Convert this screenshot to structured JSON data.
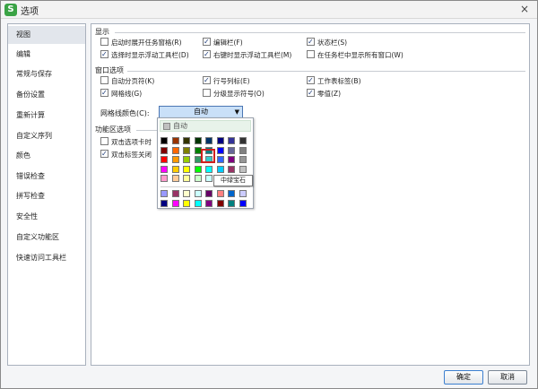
{
  "window": {
    "title": "选项",
    "close": "×"
  },
  "sidebar": {
    "items": [
      {
        "label": "视图",
        "active": true
      },
      {
        "label": "编辑"
      },
      {
        "label": "常规与保存"
      },
      {
        "label": "备份设置"
      },
      {
        "label": "重新计算"
      },
      {
        "label": "自定义序列"
      },
      {
        "label": "颜色"
      },
      {
        "label": "错误检查"
      },
      {
        "label": "拼写检查"
      },
      {
        "label": "安全性"
      },
      {
        "label": "自定义功能区"
      },
      {
        "label": "快速访问工具栏"
      }
    ]
  },
  "display": {
    "title": "显示",
    "options": [
      {
        "label": "启动时展开任务窗格(R)",
        "checked": false
      },
      {
        "label": "编辑栏(F)",
        "checked": true
      },
      {
        "label": "状态栏(S)",
        "checked": true
      },
      {
        "label": "选择时显示浮动工具栏(D)",
        "checked": true
      },
      {
        "label": "右键时显示浮动工具栏(M)",
        "checked": true
      },
      {
        "label": "在任务栏中显示所有窗口(W)",
        "checked": false
      }
    ]
  },
  "window_options": {
    "title": "窗口选项",
    "options": [
      {
        "label": "自动分页符(K)",
        "checked": false
      },
      {
        "label": "行号列标(E)",
        "checked": true
      },
      {
        "label": "工作表标签(B)",
        "checked": true
      },
      {
        "label": "网格线(G)",
        "checked": true
      },
      {
        "label": "分级显示符号(O)",
        "checked": false
      },
      {
        "label": "零值(Z)",
        "checked": true
      }
    ],
    "gridline_color_label": "网格线颜色(C):",
    "gridline_color_value": "自动",
    "dropdown_arrow": "▼"
  },
  "ribbon": {
    "title": "功能区选项",
    "options": [
      {
        "label": "双击选项卡时",
        "checked": false
      },
      {
        "label": "双击标签关闭",
        "checked": true
      }
    ]
  },
  "color_popup": {
    "auto_label": "自动",
    "hovered_color_name": "中绿宝石",
    "palette": [
      [
        "#000000",
        "#993300",
        "#333300",
        "#003300",
        "#003366",
        "#000080",
        "#333399",
        "#333333"
      ],
      [
        "#800000",
        "#ff6600",
        "#808000",
        "#008000",
        "#008080",
        "#0000ff",
        "#666699",
        "#808080"
      ],
      [
        "#ff0000",
        "#ff9900",
        "#99cc00",
        "#339966",
        "#33cccc",
        "#3366ff",
        "#800080",
        "#969696"
      ],
      [
        "#ff00ff",
        "#ffcc00",
        "#ffff00",
        "#00ff00",
        "#00ffff",
        "#00ccff",
        "#993366",
        "#c0c0c0"
      ],
      [
        "#ff99cc",
        "#ffcc99",
        "#ffff99",
        "#ccffcc",
        "#ccffff",
        "#99ccff",
        "#cc99ff",
        "#ffffff"
      ]
    ],
    "recent": [
      [
        "#9999ff",
        "#993366",
        "#ffffcc",
        "#ccffff",
        "#660066",
        "#ff8080",
        "#0066cc",
        "#ccccff"
      ],
      [
        "#000080",
        "#ff00ff",
        "#ffff00",
        "#00ffff",
        "#800080",
        "#800000",
        "#008080",
        "#0000ff"
      ]
    ]
  },
  "buttons": {
    "ok": "确定",
    "cancel": "取消"
  }
}
